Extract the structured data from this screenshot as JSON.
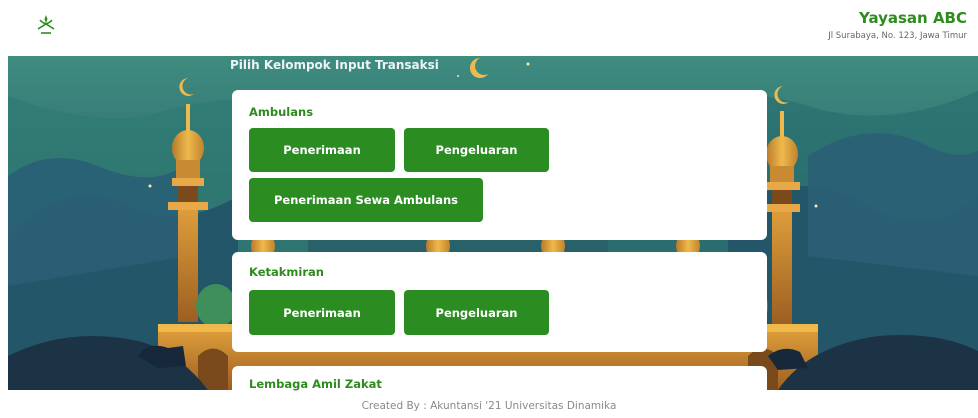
{
  "header": {
    "org_name": "Yayasan ABC",
    "org_address": "Jl Surabaya, No. 123, Jawa Timur",
    "logo_icon": "crescent-star-logo-icon"
  },
  "main": {
    "heading": "Pilih Kelompok Input Transaksi",
    "sections": [
      {
        "title": "Ambulans",
        "buttons": [
          "Penerimaan",
          "Pengeluaran",
          "Penerimaan Sewa Ambulans"
        ]
      },
      {
        "title": "Ketakmiran",
        "buttons": [
          "Penerimaan",
          "Pengeluaran"
        ]
      },
      {
        "title": "Lembaga Amil Zakat",
        "buttons": []
      }
    ]
  },
  "footer": {
    "credit": "Created By : Akuntansi '21 Universitas Dinamika"
  },
  "colors": {
    "accent": "#2e8b1e",
    "button": "#2b8c22",
    "background_dark": "#1f4a58"
  }
}
